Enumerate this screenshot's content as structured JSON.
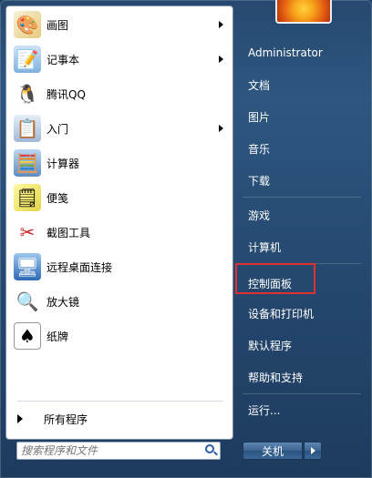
{
  "pinned_items": [
    {
      "label": "画图",
      "icon": "paint-icon",
      "submenu": true
    },
    {
      "label": "记事本",
      "icon": "notepad-icon",
      "submenu": true
    },
    {
      "label": "腾讯QQ",
      "icon": "qq-penguin-icon",
      "submenu": false
    },
    {
      "label": "入门",
      "icon": "getting-started-icon",
      "submenu": true
    },
    {
      "label": "计算器",
      "icon": "calculator-icon",
      "submenu": false
    },
    {
      "label": "便笺",
      "icon": "sticky-notes-icon",
      "submenu": false
    },
    {
      "label": "截图工具",
      "icon": "snipping-tool-icon",
      "submenu": false
    },
    {
      "label": "远程桌面连接",
      "icon": "remote-desktop-icon",
      "submenu": false
    },
    {
      "label": "放大镜",
      "icon": "magnifier-icon",
      "submenu": false
    },
    {
      "label": "纸牌",
      "icon": "solitaire-icon",
      "submenu": false
    }
  ],
  "all_programs_label": "所有程序",
  "search": {
    "placeholder": "搜索程序和文件"
  },
  "right_items": [
    {
      "label": "Administrator"
    },
    {
      "label": "文档"
    },
    {
      "label": "图片"
    },
    {
      "label": "音乐"
    },
    {
      "label": "下载"
    },
    {
      "label": "游戏"
    },
    {
      "label": "计算机"
    },
    {
      "label": "控制面板"
    },
    {
      "label": "设备和打印机"
    },
    {
      "label": "默认程序"
    },
    {
      "label": "帮助和支持"
    },
    {
      "label": "运行..."
    }
  ],
  "shutdown_label": "关机",
  "colors": {
    "highlight": "#e03030",
    "menu_blue": "#2d5780"
  }
}
